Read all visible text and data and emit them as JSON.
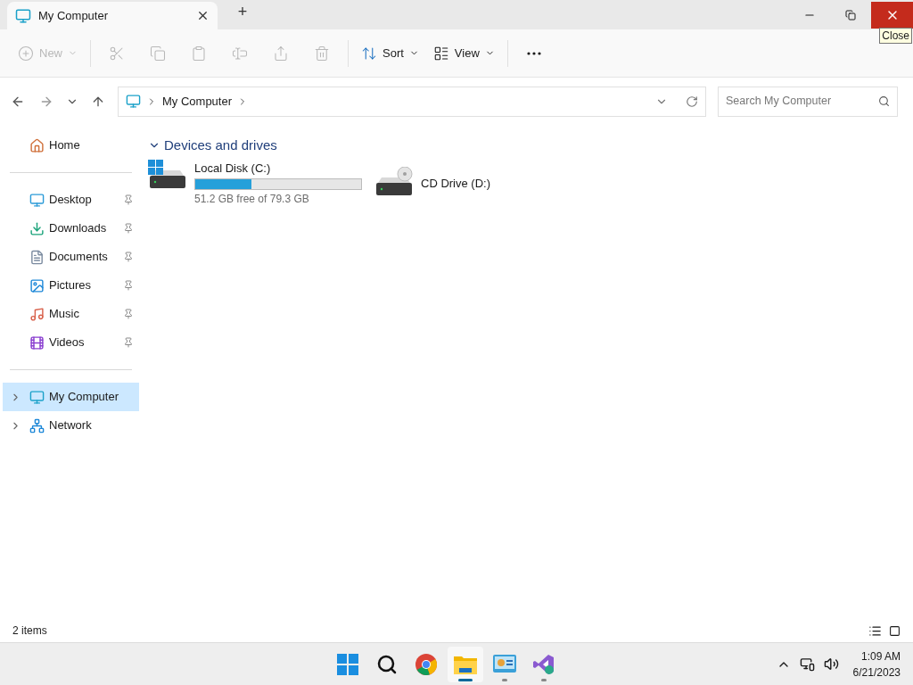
{
  "window": {
    "tab_title": "My Computer",
    "new_tab": "+",
    "tooltip": "Close"
  },
  "toolbar": [
    {
      "kind": "new",
      "label": "New",
      "disabled": true
    },
    {
      "kind": "cut",
      "disabled": true
    },
    {
      "kind": "copy",
      "disabled": true
    },
    {
      "kind": "paste",
      "disabled": true
    },
    {
      "kind": "rename",
      "disabled": true
    },
    {
      "kind": "share",
      "disabled": true
    },
    {
      "kind": "delete",
      "disabled": true
    },
    {
      "kind": "sort",
      "label": "Sort",
      "disabled": false
    },
    {
      "kind": "view",
      "label": "View",
      "disabled": false
    },
    {
      "kind": "more",
      "disabled": false
    }
  ],
  "address": {
    "path": [
      "My Computer"
    ],
    "search_placeholder": "Search My Computer"
  },
  "sidebar": {
    "groups": [
      [
        {
          "kind": "home",
          "label": "Home",
          "pinned": false,
          "selected": false,
          "expandable": false
        }
      ],
      [
        {
          "kind": "desktop",
          "label": "Desktop",
          "pinned": true,
          "selected": false,
          "expandable": false
        },
        {
          "kind": "downloads",
          "label": "Downloads",
          "pinned": true,
          "selected": false,
          "expandable": false
        },
        {
          "kind": "documents",
          "label": "Documents",
          "pinned": true,
          "selected": false,
          "expandable": false
        },
        {
          "kind": "pictures",
          "label": "Pictures",
          "pinned": true,
          "selected": false,
          "expandable": false
        },
        {
          "kind": "music",
          "label": "Music",
          "pinned": true,
          "selected": false,
          "expandable": false
        },
        {
          "kind": "videos",
          "label": "Videos",
          "pinned": true,
          "selected": false,
          "expandable": false
        }
      ],
      [
        {
          "kind": "computer",
          "label": "My Computer",
          "pinned": false,
          "selected": true,
          "expandable": true
        },
        {
          "kind": "network",
          "label": "Network",
          "pinned": false,
          "selected": false,
          "expandable": true
        }
      ]
    ]
  },
  "section": {
    "title": "Devices and drives",
    "expanded": true
  },
  "drives": [
    {
      "kind": "system",
      "name": "Local Disk (C:)",
      "level": 0.34,
      "space": "51.2 GB free of 79.3 GB"
    },
    {
      "kind": "cd",
      "name": "CD Drive (D:)"
    }
  ],
  "status_bar": {
    "count": "2 items"
  },
  "taskbar": {
    "apps": [
      {
        "kind": "start",
        "running": false,
        "selected": false
      },
      {
        "kind": "search",
        "running": false,
        "selected": false
      },
      {
        "kind": "browser",
        "running": false,
        "selected": false
      },
      {
        "kind": "explorer",
        "running": true,
        "selected": true
      },
      {
        "kind": "control",
        "running": true,
        "selected": false
      },
      {
        "kind": "studio",
        "running": true,
        "selected": false
      }
    ],
    "time": "1:09 AM",
    "date": "6/21/2023"
  }
}
